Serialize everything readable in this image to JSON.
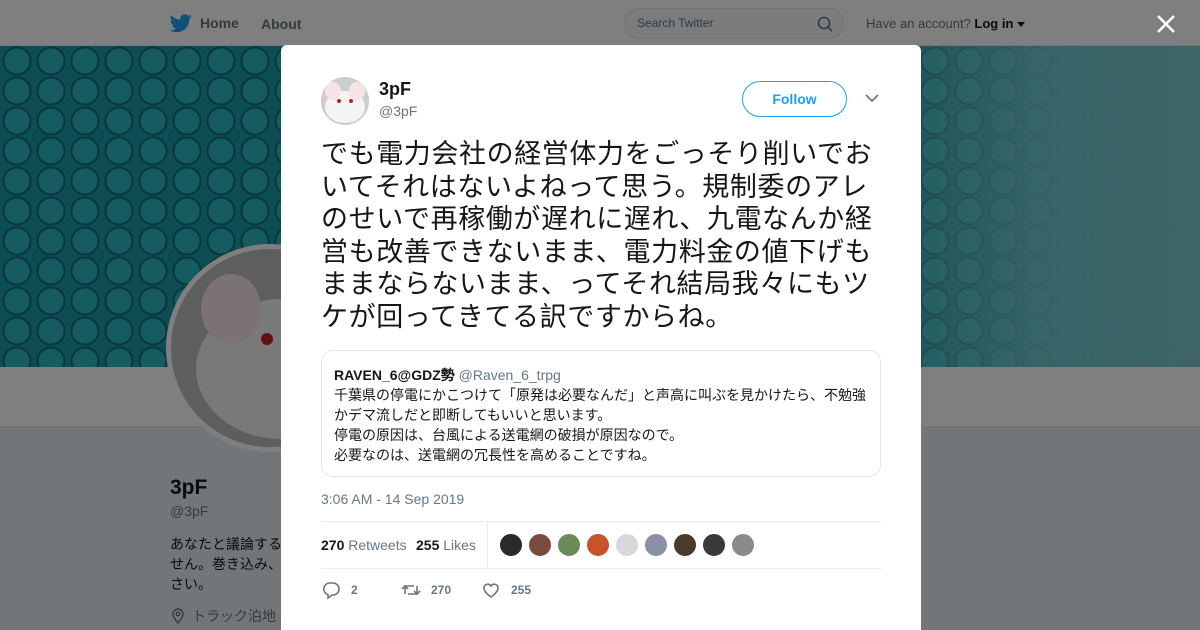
{
  "topbar": {
    "home_label": "Home",
    "about_label": "About",
    "search_placeholder": "Search Twitter",
    "account_prompt": "Have an account?",
    "login_label": "Log in"
  },
  "profile_bg": {
    "name": "3pF",
    "handle": "@3pF",
    "bio_lines": [
      "あなたと議論する",
      "せん。巻き込み、",
      "さい。"
    ],
    "location": "トラック泊地"
  },
  "tweet": {
    "author_name": "3pF",
    "author_handle": "@3pF",
    "follow_label": "Follow",
    "text": "でも電力会社の経営体力をごっそり削いでおいてそれはないよねって思う。規制委のアレのせいで再稼働が遅れに遅れ、九電なんか経営も改善できないまま、電力料金の値下げもままならないまま、ってそれ結局我々にもツケが回ってきてる訳ですからね。",
    "timestamp": "3:06 AM - 14 Sep 2019",
    "retweet_count": "270",
    "retweet_label": "Retweets",
    "like_count": "255",
    "like_label": "Likes",
    "reply_count": "2",
    "action_retweet_count": "270",
    "action_like_count": "255"
  },
  "quote": {
    "name": "RAVEN_6@GDZ勢",
    "handle": "@Raven_6_trpg",
    "lines": [
      "千葉県の停電にかこつけて「原発は必要なんだ」と声高に叫ぶを見かけたら、不勉強かデマ流しだと即断してもいいと思います。",
      "停電の原因は、台風による送電網の破損が原因なので。",
      "必要なのは、送電網の冗長性を高めることですね。"
    ]
  },
  "likers": {
    "colors": [
      "#2a2a2a",
      "#7a4a3a",
      "#6a8a5a",
      "#c8522a",
      "#d8d8d8",
      "#8a8fa8",
      "#4a3a2a",
      "#3a3a3a",
      "#8a8a8a"
    ]
  },
  "colors": {
    "accent": "#1da1f2",
    "banner": "#1d9aa6"
  }
}
